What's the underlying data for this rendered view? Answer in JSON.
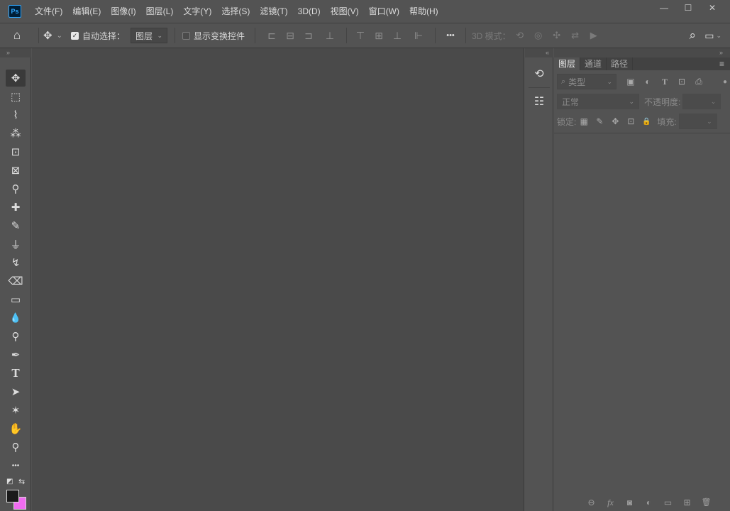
{
  "app": {
    "logo_text": "Ps"
  },
  "menu": [
    "文件(F)",
    "编辑(E)",
    "图像(I)",
    "图层(L)",
    "文字(Y)",
    "选择(S)",
    "滤镜(T)",
    "3D(D)",
    "视图(V)",
    "窗口(W)",
    "帮助(H)"
  ],
  "window_controls": {
    "minimize": "—",
    "maximize": "☐",
    "close": "✕"
  },
  "options": {
    "home_icon": "⌂",
    "move_icon": "✥",
    "move_dropdown_icon": "⌄",
    "auto_select_label": "自动选择：",
    "auto_select_checked": true,
    "auto_select_target": "图层",
    "show_transform_label": "显示变换控件",
    "show_transform_checked": false,
    "align_icons": [
      "⊏",
      "⊟",
      "⊐",
      "⊥",
      "⊤",
      "⊞",
      "⊥",
      "⊩"
    ],
    "more_icon": "•••",
    "mode_3d_label": "3D 模式：",
    "mode_3d_icons": [
      "⟲",
      "◎",
      "✣",
      "⇄",
      "▶"
    ],
    "search_icon": "⌕",
    "workspace_icon": "▭"
  },
  "collapse": {
    "left": "»",
    "right": "«",
    "far_right": "»"
  },
  "tools": [
    {
      "name": "move-tool",
      "glyph": "✥"
    },
    {
      "name": "marquee-tool",
      "glyph": "⬚"
    },
    {
      "name": "lasso-tool",
      "glyph": "⌇"
    },
    {
      "name": "magic-wand-tool",
      "glyph": "⁂"
    },
    {
      "name": "crop-tool",
      "glyph": "⊡"
    },
    {
      "name": "frame-tool",
      "glyph": "⊠"
    },
    {
      "name": "eyedropper-tool",
      "glyph": "⚲"
    },
    {
      "name": "healing-brush-tool",
      "glyph": "✚"
    },
    {
      "name": "brush-tool",
      "glyph": "✎"
    },
    {
      "name": "clone-stamp-tool",
      "glyph": "⏚"
    },
    {
      "name": "history-brush-tool",
      "glyph": "↯"
    },
    {
      "name": "eraser-tool",
      "glyph": "⌫"
    },
    {
      "name": "gradient-tool",
      "glyph": "▭"
    },
    {
      "name": "blur-tool",
      "glyph": "💧"
    },
    {
      "name": "dodge-tool",
      "glyph": "⚲"
    },
    {
      "name": "pen-tool",
      "glyph": "✒"
    },
    {
      "name": "type-tool",
      "glyph": "T"
    },
    {
      "name": "path-selection-tool",
      "glyph": "➤"
    },
    {
      "name": "shape-tool",
      "glyph": "✶"
    },
    {
      "name": "hand-tool",
      "glyph": "✋"
    },
    {
      "name": "zoom-tool",
      "glyph": "⚲"
    },
    {
      "name": "more-tools",
      "glyph": "•••"
    }
  ],
  "swatch_controls": {
    "default_icon": "◩",
    "swap_icon": "⇆"
  },
  "colors": {
    "foreground": "#1a1a1a",
    "background": "#f06cf0"
  },
  "dock": {
    "history_icon": "⟲",
    "properties_icon": "☷"
  },
  "layers_panel": {
    "tabs": [
      "图层",
      "通道",
      "路径"
    ],
    "active_tab": 0,
    "menu_icon": "≡",
    "filter_placeholder": "类型",
    "filter_icon": "⌕",
    "filter_icons": [
      "▣",
      "◐",
      "T",
      "⊡",
      "⎙"
    ],
    "filter_toggle_icon": "●",
    "blend_mode": "正常",
    "opacity_label": "不透明度:",
    "lock_label": "锁定:",
    "lock_icons": [
      "▦",
      "✎",
      "✥",
      "⊡",
      "🔒"
    ],
    "fill_label": "填充:",
    "bottom_icons": [
      "⊖",
      "fx",
      "◙",
      "◐",
      "▭",
      "⊞",
      "🗑"
    ]
  }
}
